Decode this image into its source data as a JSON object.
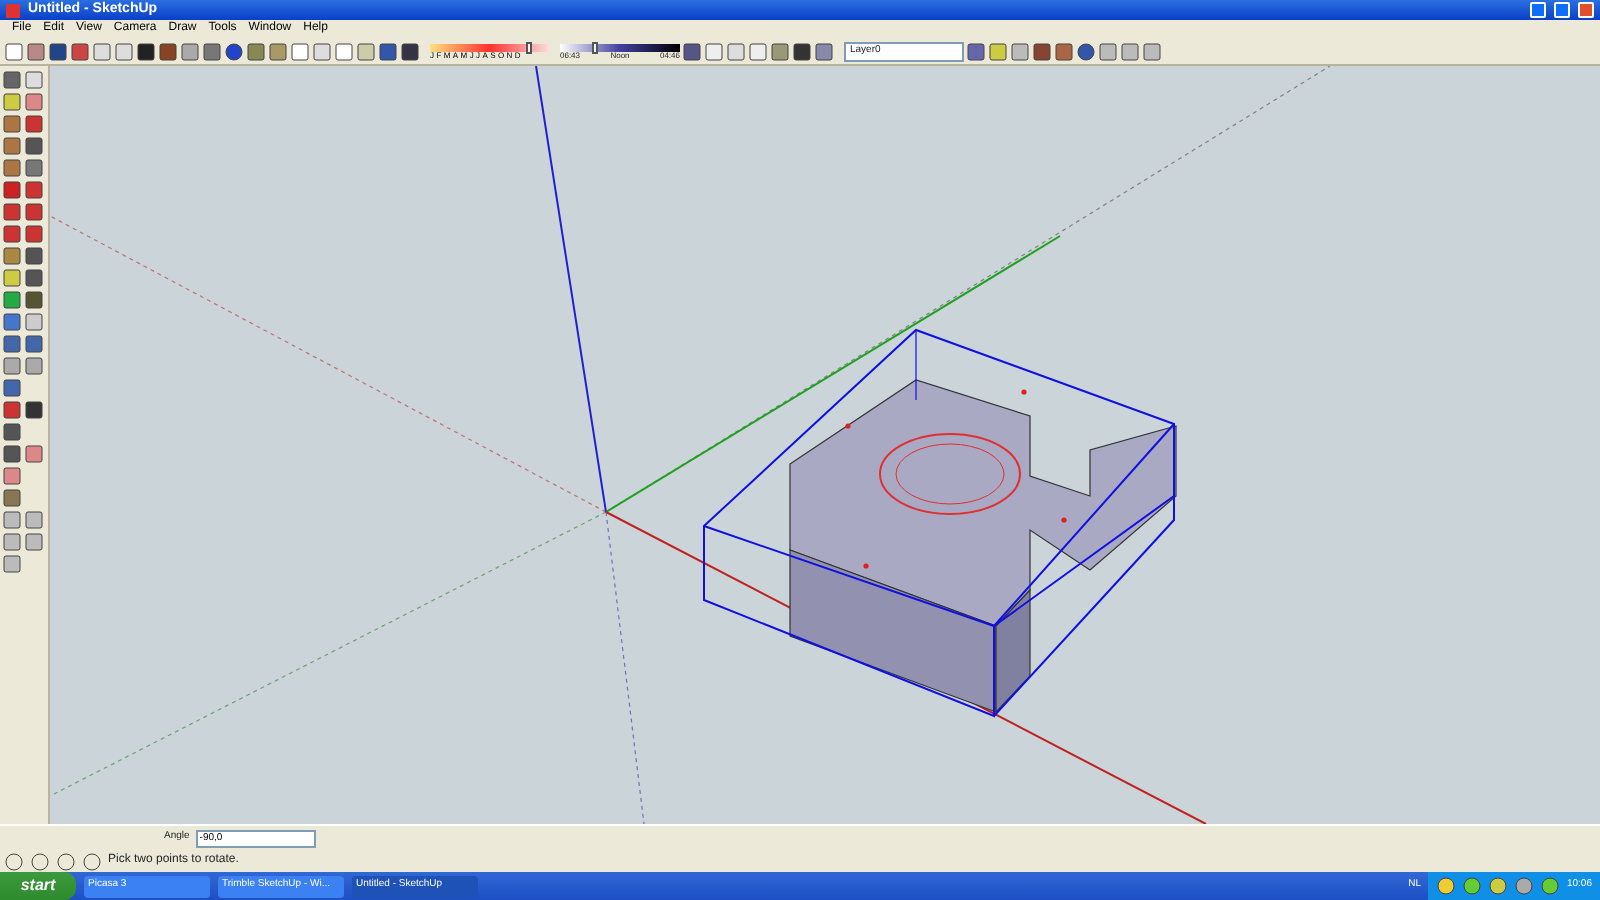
{
  "window": {
    "title": "Untitled - SketchUp"
  },
  "menu": [
    "File",
    "Edit",
    "View",
    "Camera",
    "Draw",
    "Tools",
    "Window",
    "Help"
  ],
  "shadow_settings": {
    "date_slider": {
      "level": 0.83
    },
    "time_slider": {
      "level": 0.3
    },
    "months": [
      "J",
      "F",
      "M",
      "A",
      "M",
      "J",
      "J",
      "A",
      "S",
      "O",
      "N",
      "D"
    ],
    "time_start": "06:43",
    "time_mid": "Noon",
    "time_end": "04:46"
  },
  "layer_dropdown": {
    "value": "Layer0"
  },
  "measurements": {
    "label": "Angle",
    "value": "-90,0"
  },
  "status_bar": {
    "message": "Pick two points to rotate."
  },
  "taskbar": {
    "start": "start",
    "tasks": [
      {
        "label": "Picasa 3",
        "selected": false
      },
      {
        "label": "Trimble SketchUp - Wi...",
        "selected": false
      },
      {
        "label": "Untitled - SketchUp",
        "selected": true
      }
    ],
    "language": "NL",
    "clock": "10:06"
  }
}
